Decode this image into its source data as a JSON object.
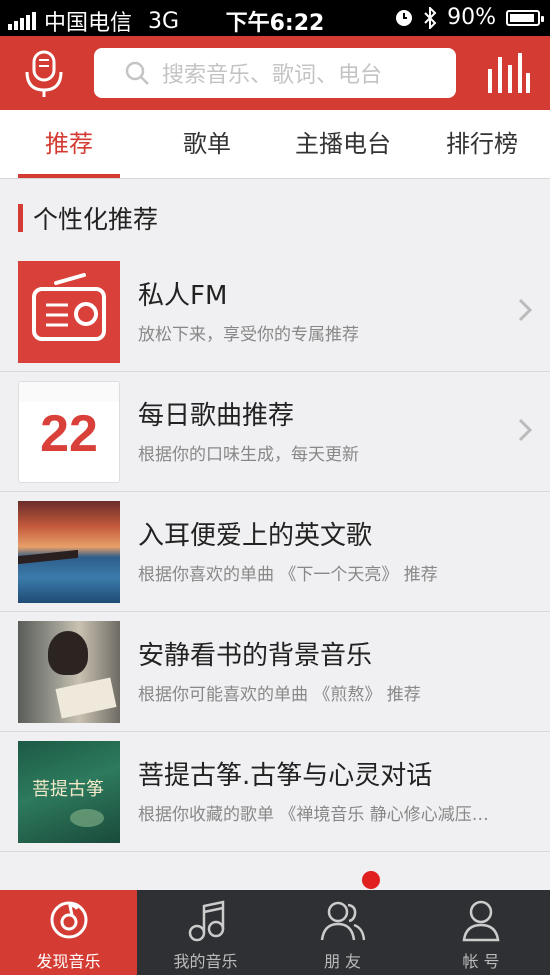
{
  "status_bar": {
    "carrier": "中国电信",
    "network": "3G",
    "time": "下午6:22",
    "battery": "90%"
  },
  "header": {
    "search_placeholder": "搜索音乐、歌词、电台",
    "icons": [
      "microphone-icon",
      "equalizer-icon",
      "search-icon"
    ]
  },
  "tabs": [
    {
      "label": "推荐",
      "active": true
    },
    {
      "label": "歌单",
      "active": false
    },
    {
      "label": "主播电台",
      "active": false
    },
    {
      "label": "排行榜",
      "active": false
    }
  ],
  "section": {
    "title": "个性化推荐"
  },
  "items": [
    {
      "title": "私人FM",
      "subtitle": "放松下来，享受你的专属推荐",
      "icon": "radio-icon"
    },
    {
      "title": "每日歌曲推荐",
      "subtitle": "根据你的口味生成，每天更新",
      "calendar_day": "22"
    },
    {
      "title": "入耳便爱上的英文歌",
      "subtitle": "根据你喜欢的单曲 《下一个天亮》 推荐"
    },
    {
      "title": "安静看书的背景音乐",
      "subtitle": "根据你可能喜欢的单曲 《煎熬》 推荐"
    },
    {
      "title": "菩提古筝.古筝与心灵对话",
      "subtitle": "根据你收藏的歌单 《禅境音乐 静心修心减压…",
      "cover_text": "菩提古筝"
    }
  ],
  "tab_bar": [
    {
      "label": "发现音乐",
      "icon": "netease-logo-icon",
      "active": true
    },
    {
      "label": "我的音乐",
      "icon": "music-note-icon",
      "active": false
    },
    {
      "label": "朋 友",
      "icon": "friends-icon",
      "active": false,
      "badge": true
    },
    {
      "label": "帐 号",
      "icon": "user-icon",
      "active": false
    }
  ],
  "colors": {
    "brand_red": "#d43c33",
    "tab_bar_bg": "#2f3033"
  }
}
